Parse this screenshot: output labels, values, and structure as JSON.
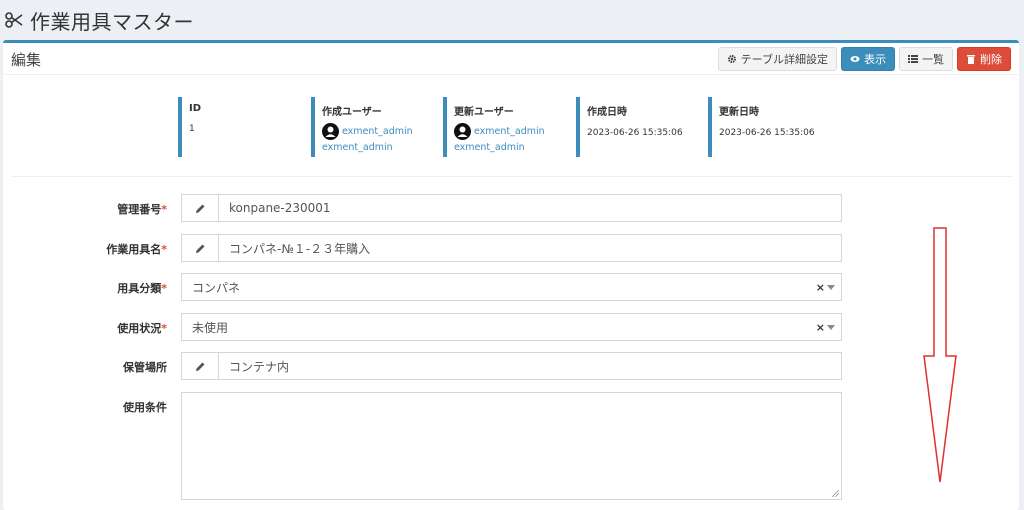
{
  "page": {
    "title": "作業用具マスター",
    "header_icon": "scissors-icon"
  },
  "box": {
    "title": "編集"
  },
  "toolbar": {
    "table_settings": "テーブル詳細設定",
    "view": "表示",
    "list": "一覧",
    "delete": "削除"
  },
  "info": [
    {
      "label": "ID",
      "value": "1"
    },
    {
      "label": "作成ユーザー",
      "user": "exment_admin",
      "user2": "exment_admin"
    },
    {
      "label": "更新ユーザー",
      "user": "exment_admin",
      "user2": "exment_admin"
    },
    {
      "label": "作成日時",
      "value": "2023-06-26 15:35:06"
    },
    {
      "label": "更新日時",
      "value": "2023-06-26 15:35:06"
    }
  ],
  "form": {
    "fields": [
      {
        "label": "管理番号",
        "required": "*",
        "value": "konpane-230001"
      },
      {
        "label": "作業用具名",
        "required": "*",
        "value": "コンパネ-№１-２３年購入"
      },
      {
        "label": "用具分類",
        "required": "*",
        "value": "コンパネ",
        "clear": "×"
      },
      {
        "label": "使用状況",
        "required": "*",
        "value": "未使用",
        "clear": "×"
      },
      {
        "label": "保管場所",
        "required": "",
        "value": "コンテナ内"
      },
      {
        "label": "使用条件",
        "required": "",
        "value": ""
      }
    ]
  },
  "colors": {
    "accent": "#3c8dbc",
    "danger": "#dd4b39",
    "annotation": "#e03030"
  }
}
